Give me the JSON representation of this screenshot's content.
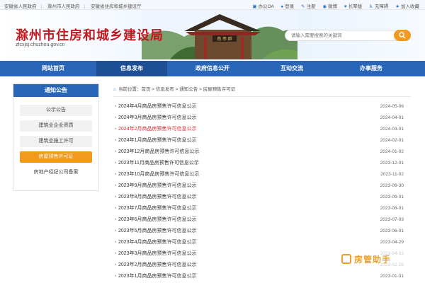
{
  "topbar": {
    "links": [
      "安徽省人民政府",
      "滁州市人民政府",
      "安徽省住房和城乡建设厅"
    ],
    "right": [
      "办公OA",
      "登录",
      "注册",
      "微博",
      "长辈版",
      "无障碍",
      "加入收藏"
    ]
  },
  "header": {
    "title": "滁州市住房和城乡建设局",
    "domain": "zfcxjsj.chuzhou.gov.cn",
    "plaque": "南 亭 醉",
    "search_placeholder": "请输入需要搜索的关键词"
  },
  "nav": [
    "网站首页",
    "信息发布",
    "政府信息公开",
    "互动交流",
    "办事服务"
  ],
  "sidebar": {
    "title": "通知公告",
    "items": [
      "公示公告",
      "建筑业企业资质",
      "建筑业施工许可",
      "房屋预售许可证",
      "房地产经纪公司备案"
    ]
  },
  "breadcrumb": {
    "prefix": "当前位置：",
    "path": "首页 > 信息发布 > 通知公告 > 房屋预售许可证"
  },
  "list": [
    {
      "title": "2024年4月商品房预售许可信息公示",
      "date": "2024-05-06"
    },
    {
      "title": "2024年3月商品房预售许可信息公示",
      "date": "2024-04-01"
    },
    {
      "title": "2024年2月商品房预售许可信息公示",
      "date": "2024-03-01"
    },
    {
      "title": "2024年1月商品房预售许可信息公示",
      "date": "2024-02-01"
    },
    {
      "title": "2023年12月商品房预售许可信息公示",
      "date": "2024-01-02"
    },
    {
      "title": "2023年11月商品房预售许可信息公示",
      "date": "2023-12-01"
    },
    {
      "title": "2023年10月商品房预售许可信息公示",
      "date": "2023-11-02"
    },
    {
      "title": "2023年9月商品房预售许可信息公示",
      "date": "2023-09-30"
    },
    {
      "title": "2023年8月商品房预售许可信息公示",
      "date": "2023-09-01"
    },
    {
      "title": "2023年7月商品房预售许可信息公示",
      "date": "2023-08-01"
    },
    {
      "title": "2023年6月商品房预售许可信息公示",
      "date": "2023-07-03"
    },
    {
      "title": "2023年5月商品房预售许可信息公示",
      "date": "2023-06-01"
    },
    {
      "title": "2023年4月商品房预售许可信息公示",
      "date": "2023-04-29"
    },
    {
      "title": "2023年3月商品房预售许可信息公示",
      "date": "2023-04-03"
    },
    {
      "title": "2023年2月商品房预售许可信息公示",
      "date": "2023-02-28"
    },
    {
      "title": "2023年1月商品房预售许可信息公示",
      "date": "2023-01-31"
    }
  ],
  "watermark": "房管助手",
  "colors": {
    "nav": "#2a66b8",
    "accent": "#f19a1d",
    "title_red": "#c0191f",
    "highlight_red": "#d7282f"
  }
}
